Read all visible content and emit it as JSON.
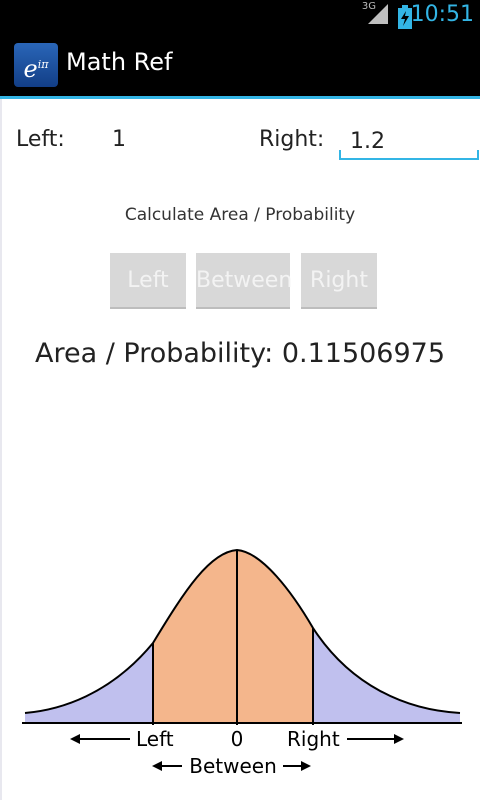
{
  "status_bar": {
    "network": "3G",
    "time": "10:51"
  },
  "app_bar": {
    "icon_text": "e",
    "icon_superscript": "iπ",
    "title": "Math Ref"
  },
  "inputs": {
    "left_label": "Left:",
    "left_value": "1",
    "right_label": "Right:",
    "right_value": "1.2"
  },
  "calculate_label": "Calculate Area / Probability",
  "buttons": {
    "left": "Left",
    "between": "Between",
    "right": "Right"
  },
  "result_text": "Area / Probability: 0.11506975",
  "diagram": {
    "label_left": "Left",
    "label_zero": "0",
    "label_right": "Right",
    "label_between": "Between",
    "colors": {
      "tail": "#c0c0ee",
      "center": "#f4b68c",
      "line": "#000000"
    }
  }
}
